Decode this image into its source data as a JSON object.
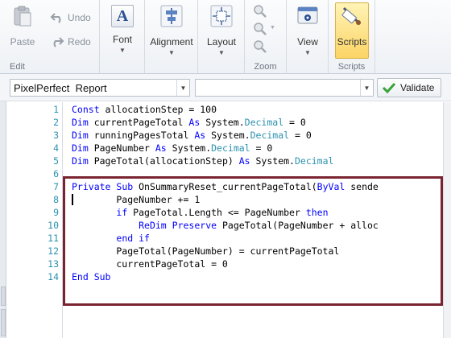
{
  "ribbon": {
    "edit_group": {
      "caption": "Edit",
      "paste": "Paste",
      "undo": "Undo",
      "redo": "Redo"
    },
    "font_group": {
      "label": "Font",
      "glyph": "A"
    },
    "alignment_group": {
      "label": "Alignment"
    },
    "layout_group": {
      "label": "Layout"
    },
    "zoom_group": {
      "caption": "Zoom"
    },
    "view_group": {
      "label": "View"
    },
    "scripts_group": {
      "label": "Scripts",
      "caption": "Scripts"
    }
  },
  "toolbar": {
    "object_combo": "PixelPerfect  Report",
    "event_combo": "",
    "validate_label": "Validate"
  },
  "editor": {
    "line_numbers": [
      "1",
      "2",
      "3",
      "4",
      "5",
      "6",
      "7",
      "8",
      "9",
      "10",
      "11",
      "12",
      "13",
      "14"
    ],
    "lines": [
      [
        {
          "t": "Const",
          "c": "kw"
        },
        {
          "t": " allocationStep = 100"
        }
      ],
      [
        {
          "t": "Dim",
          "c": "kw"
        },
        {
          "t": " currentPageTotal "
        },
        {
          "t": "As",
          "c": "kw"
        },
        {
          "t": " System."
        },
        {
          "t": "Decimal",
          "c": "ty"
        },
        {
          "t": " = 0"
        }
      ],
      [
        {
          "t": "Dim",
          "c": "kw"
        },
        {
          "t": " runningPagesTotal "
        },
        {
          "t": "As",
          "c": "kw"
        },
        {
          "t": " System."
        },
        {
          "t": "Decimal",
          "c": "ty"
        },
        {
          "t": " = 0"
        }
      ],
      [
        {
          "t": "Dim",
          "c": "kw"
        },
        {
          "t": " PageNumber "
        },
        {
          "t": "As",
          "c": "kw"
        },
        {
          "t": " System."
        },
        {
          "t": "Decimal",
          "c": "ty"
        },
        {
          "t": " = 0"
        }
      ],
      [
        {
          "t": "Dim",
          "c": "kw"
        },
        {
          "t": " PageTotal(allocationStep) "
        },
        {
          "t": "As",
          "c": "kw"
        },
        {
          "t": " System."
        },
        {
          "t": "Decimal",
          "c": "ty"
        }
      ],
      [],
      [
        {
          "t": "Private",
          "c": "kw"
        },
        {
          "t": " "
        },
        {
          "t": "Sub",
          "c": "kw"
        },
        {
          "t": " OnSummaryReset_currentPageTotal("
        },
        {
          "t": "ByVal",
          "c": "kw"
        },
        {
          "t": " sende"
        }
      ],
      [
        {
          "t": "        PageNumber += 1"
        }
      ],
      [
        {
          "t": "        "
        },
        {
          "t": "if",
          "c": "kw"
        },
        {
          "t": " PageTotal.Length <= PageNumber "
        },
        {
          "t": "then",
          "c": "kw"
        }
      ],
      [
        {
          "t": "            "
        },
        {
          "t": "ReDim",
          "c": "kw"
        },
        {
          "t": " "
        },
        {
          "t": "Preserve",
          "c": "kw"
        },
        {
          "t": " PageTotal(PageNumber + alloc"
        }
      ],
      [
        {
          "t": "        "
        },
        {
          "t": "end if",
          "c": "kw"
        }
      ],
      [
        {
          "t": "        PageTotal(PageNumber) = currentPageTotal"
        }
      ],
      [
        {
          "t": "        currentPageTotal = 0"
        }
      ],
      [
        {
          "t": "End Sub",
          "c": "kw"
        }
      ]
    ]
  },
  "colors": {
    "keyword": "#0000ff",
    "type": "#2b91af",
    "line_number": "#2b91af",
    "highlight_border": "#7a2431",
    "active_button": "#fbd466"
  },
  "icons": [
    "paste-icon",
    "undo-icon",
    "redo-icon",
    "font-icon",
    "alignment-icon",
    "layout-icon",
    "zoom-in-icon",
    "zoom-out-icon",
    "zoom-search-icon",
    "view-icon",
    "scripts-icon",
    "validate-check-icon"
  ]
}
